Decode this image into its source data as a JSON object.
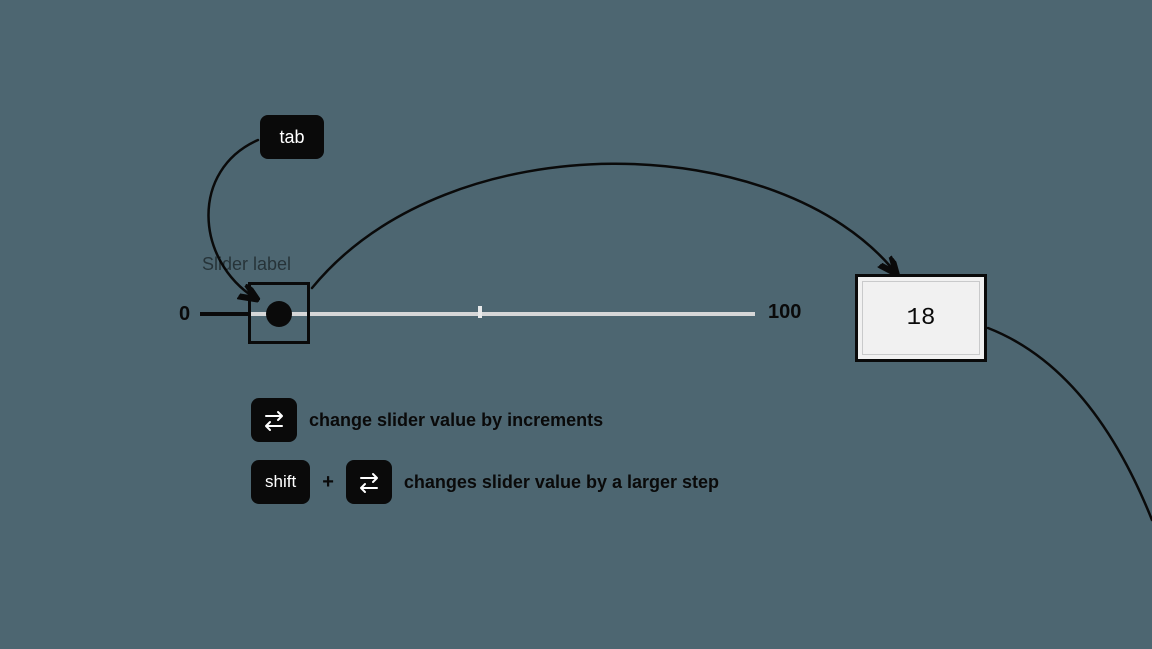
{
  "keys": {
    "tab": "tab",
    "shift": "shift"
  },
  "slider": {
    "label": "Slider label",
    "min": "0",
    "max": "100",
    "value": "18"
  },
  "hints": {
    "increment": "change slider value by increments",
    "larger_step": "changes slider value by a larger step",
    "plus": "+"
  }
}
